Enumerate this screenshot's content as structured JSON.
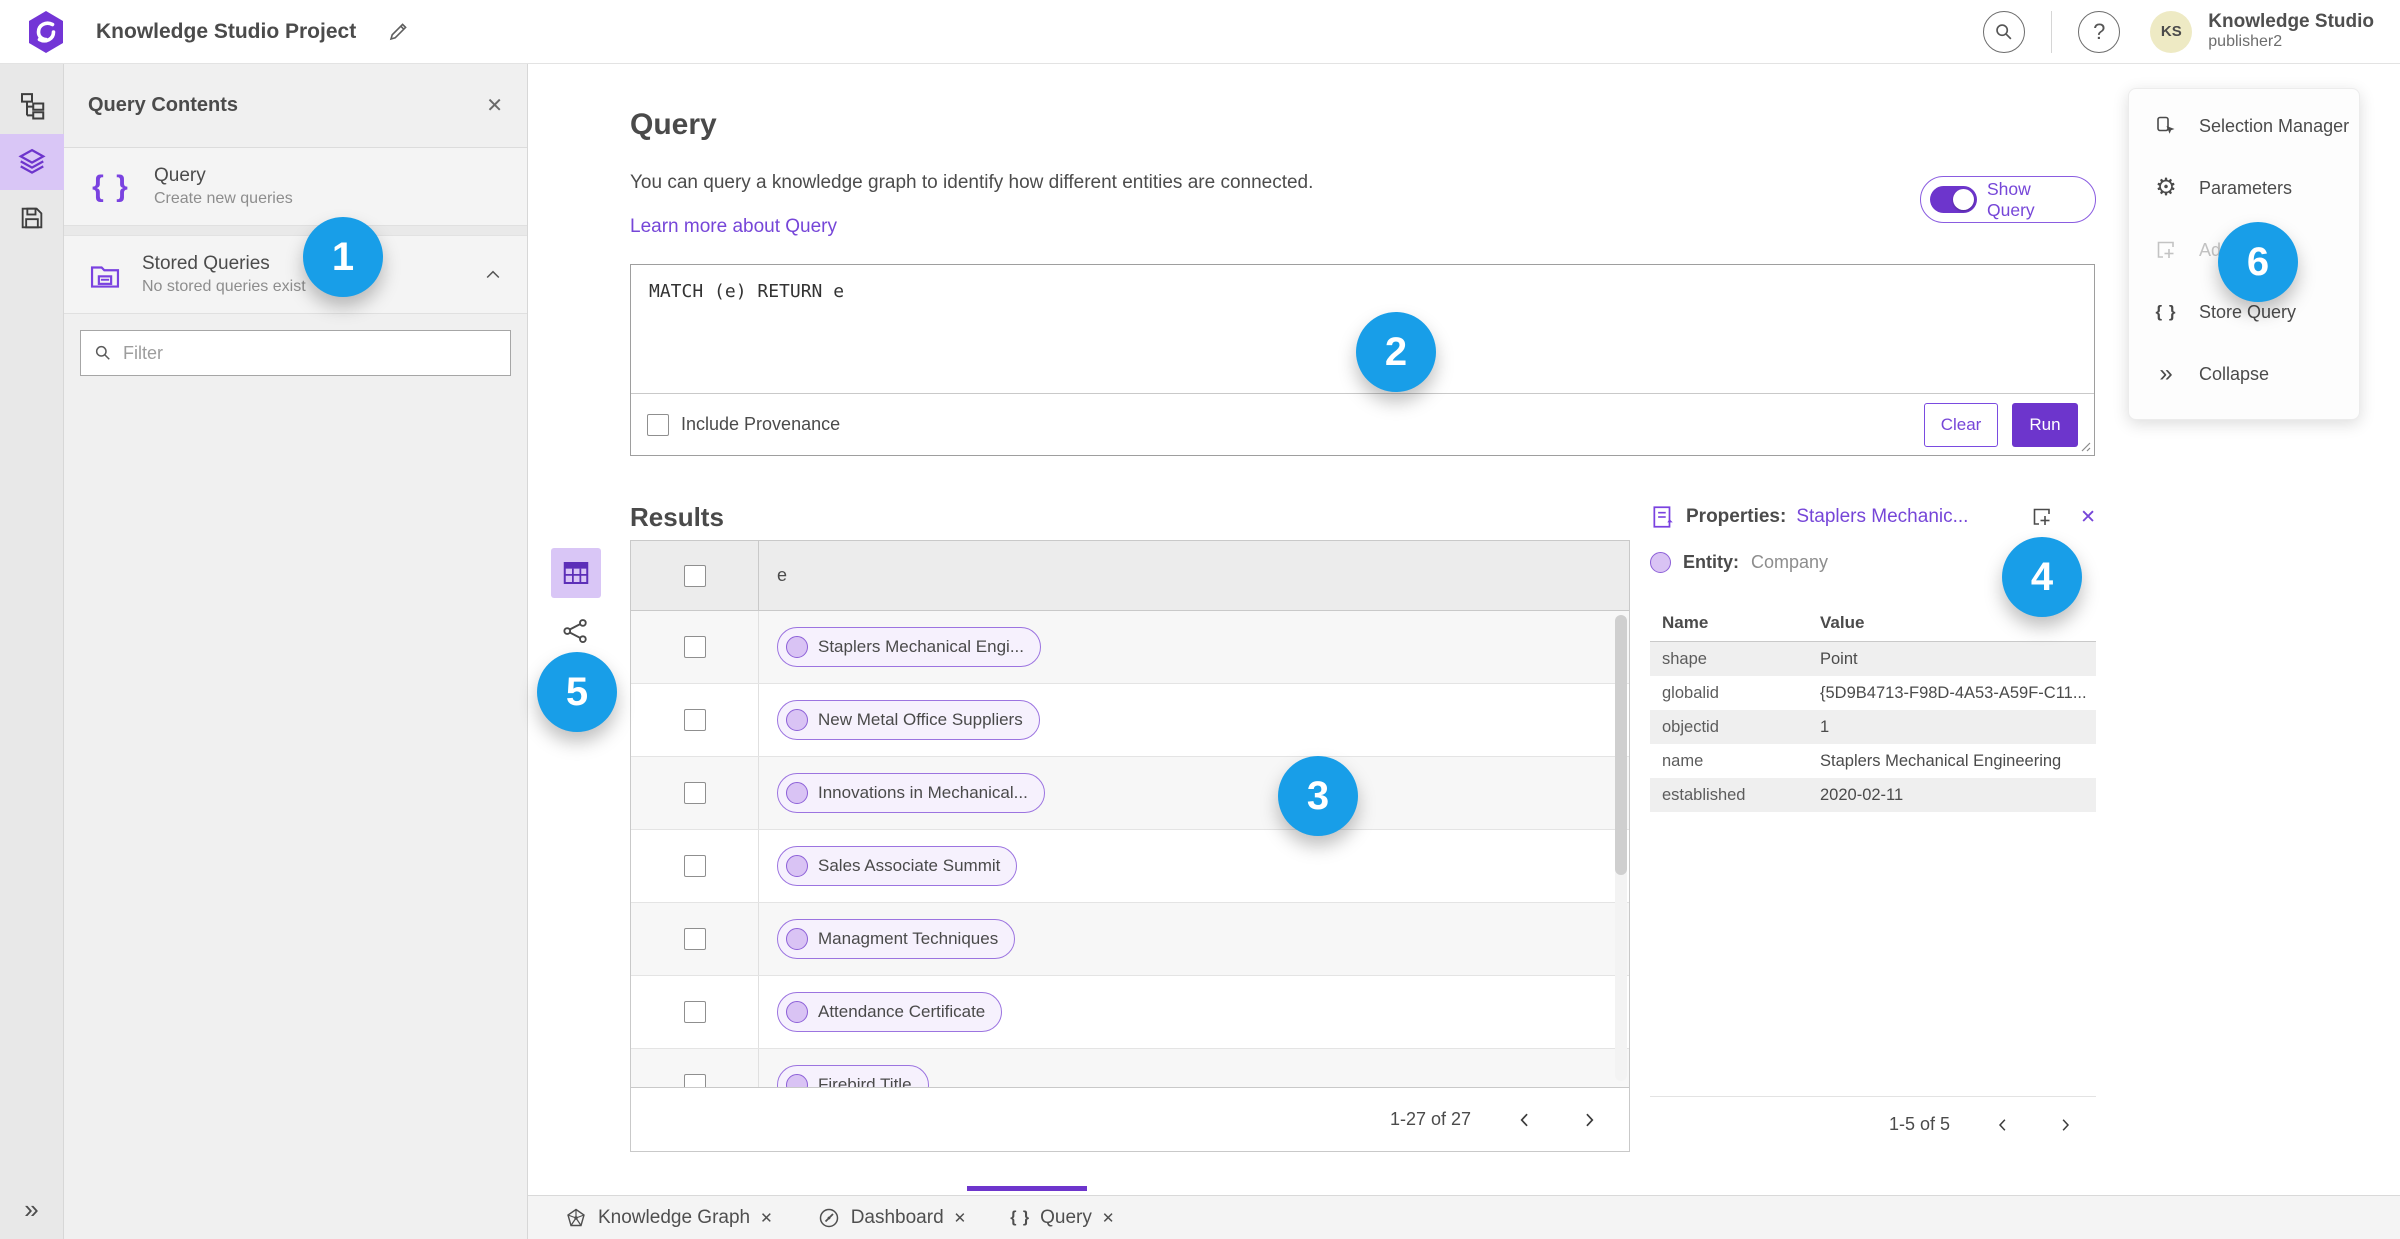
{
  "topbar": {
    "title": "Knowledge Studio Project",
    "avatar_initials": "KS",
    "user_name": "Knowledge Studio",
    "user_role": "publisher2"
  },
  "left_panel": {
    "header": "Query Contents",
    "items": [
      {
        "title": "Query",
        "subtitle": "Create new queries"
      },
      {
        "title": "Stored Queries",
        "subtitle": "No stored queries exist"
      }
    ],
    "filter_placeholder": "Filter"
  },
  "query_section": {
    "title": "Query",
    "description": "You can query a knowledge graph to identify how different entities are connected.",
    "link": "Learn more about Query",
    "toggle_label": "Show Query",
    "query_text": "MATCH (e) RETURN e",
    "provenance_label": "Include Provenance",
    "clear_label": "Clear",
    "run_label": "Run"
  },
  "results": {
    "title": "Results",
    "column": "e",
    "rows": [
      "Staplers Mechanical Engi...",
      "New Metal Office Suppliers",
      "Innovations in Mechanical...",
      "Sales Associate Summit",
      "Managment Techniques",
      "Attendance Certificate",
      "Firebird Title"
    ],
    "pagination": "1-27 of 27"
  },
  "properties": {
    "label": "Properties:",
    "entity_link": "Staplers Mechanic...",
    "entity_label": "Entity:",
    "entity_type": "Company",
    "columns": {
      "name": "Name",
      "value": "Value"
    },
    "rows": [
      {
        "name": "shape",
        "value": "Point"
      },
      {
        "name": "globalid",
        "value": "{5D9B4713-F98D-4A53-A59F-C11..."
      },
      {
        "name": "objectid",
        "value": "1"
      },
      {
        "name": "name",
        "value": "Staplers Mechanical Engineering"
      },
      {
        "name": "established",
        "value": "2020-02-11"
      }
    ],
    "pagination": "1-5 of 5"
  },
  "tools_menu": {
    "items": [
      {
        "label": "Selection Manager",
        "disabled": false
      },
      {
        "label": "Parameters",
        "disabled": false
      },
      {
        "label": "Ad",
        "disabled": true
      },
      {
        "label": "Store Query",
        "disabled": false
      },
      {
        "label": "Collapse",
        "disabled": false
      }
    ]
  },
  "tabs": [
    {
      "label": "Knowledge Graph",
      "active": false
    },
    {
      "label": "Dashboard",
      "active": false
    },
    {
      "label": "Query",
      "active": true
    }
  ],
  "badges": [
    "1",
    "2",
    "3",
    "4",
    "5",
    "6"
  ],
  "colors": {
    "accent_purple": "#6D35CC",
    "link_purple": "#7646D8",
    "light_purple": "#D9C6F6",
    "badge_blue": "#189EE8"
  }
}
